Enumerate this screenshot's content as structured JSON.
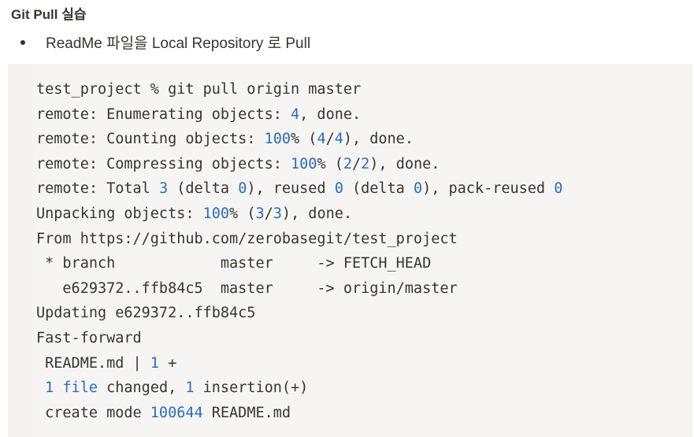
{
  "heading": "Git Pull 실습",
  "bullet": "ReadMe 파일을 Local Repository 로 Pull",
  "colors": {
    "text": "#37352f",
    "number": "#2a6dbe",
    "code_background": "#f6f5f3"
  },
  "code_lines": [
    [
      {
        "t": "test_project % git pull origin master",
        "k": "plain"
      }
    ],
    [
      {
        "t": "remote: Enumerating objects: ",
        "k": "plain"
      },
      {
        "t": "4",
        "k": "num"
      },
      {
        "t": ", done.",
        "k": "plain"
      }
    ],
    [
      {
        "t": "remote: Counting objects: ",
        "k": "plain"
      },
      {
        "t": "100",
        "k": "num"
      },
      {
        "t": "% (",
        "k": "plain"
      },
      {
        "t": "4",
        "k": "num"
      },
      {
        "t": "/",
        "k": "plain"
      },
      {
        "t": "4",
        "k": "num"
      },
      {
        "t": "), done.",
        "k": "plain"
      }
    ],
    [
      {
        "t": "remote: Compressing objects: ",
        "k": "plain"
      },
      {
        "t": "100",
        "k": "num"
      },
      {
        "t": "% (",
        "k": "plain"
      },
      {
        "t": "2",
        "k": "num"
      },
      {
        "t": "/",
        "k": "plain"
      },
      {
        "t": "2",
        "k": "num"
      },
      {
        "t": "), done.",
        "k": "plain"
      }
    ],
    [
      {
        "t": "remote: Total ",
        "k": "plain"
      },
      {
        "t": "3",
        "k": "num"
      },
      {
        "t": " (delta ",
        "k": "plain"
      },
      {
        "t": "0",
        "k": "num"
      },
      {
        "t": "), reused ",
        "k": "plain"
      },
      {
        "t": "0",
        "k": "num"
      },
      {
        "t": " (delta ",
        "k": "plain"
      },
      {
        "t": "0",
        "k": "num"
      },
      {
        "t": "), pack-reused ",
        "k": "plain"
      },
      {
        "t": "0",
        "k": "num"
      }
    ],
    [
      {
        "t": "Unpacking objects: ",
        "k": "plain"
      },
      {
        "t": "100",
        "k": "num"
      },
      {
        "t": "% (",
        "k": "plain"
      },
      {
        "t": "3",
        "k": "num"
      },
      {
        "t": "/",
        "k": "plain"
      },
      {
        "t": "3",
        "k": "num"
      },
      {
        "t": "), done.",
        "k": "plain"
      }
    ],
    [
      {
        "t": "From https://github.com/zerobasegit/test_project",
        "k": "plain"
      }
    ],
    [
      {
        "t": " * branch            master     -> FETCH_HEAD",
        "k": "plain"
      }
    ],
    [
      {
        "t": "   e629372..ffb84c5  master     -> origin/master",
        "k": "plain"
      }
    ],
    [
      {
        "t": "Updating e629372..ffb84c5",
        "k": "plain"
      }
    ],
    [
      {
        "t": "Fast-forward",
        "k": "plain"
      }
    ],
    [
      {
        "t": " README.md | ",
        "k": "plain"
      },
      {
        "t": "1",
        "k": "num"
      },
      {
        "t": " +",
        "k": "plain"
      }
    ],
    [
      {
        "t": " ",
        "k": "plain"
      },
      {
        "t": "1",
        "k": "num"
      },
      {
        "t": " file",
        "k": "num"
      },
      {
        "t": " changed, ",
        "k": "plain"
      },
      {
        "t": "1",
        "k": "num"
      },
      {
        "t": " insertion(+)",
        "k": "plain"
      }
    ],
    [
      {
        "t": " create mode ",
        "k": "plain"
      },
      {
        "t": "100644",
        "k": "num"
      },
      {
        "t": " README.md",
        "k": "plain"
      }
    ]
  ]
}
